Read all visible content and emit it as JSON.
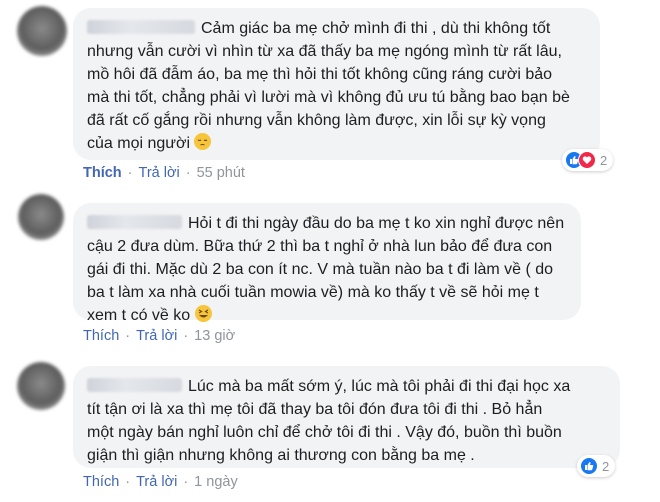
{
  "actions": {
    "like_label": "Thích",
    "reply_label": "Trả lời",
    "separator": "·"
  },
  "comments": [
    {
      "text": "Cảm giác ba mẹ chở mình đi thi , dù thi không tốt\nnhưng vẫn cười vì nhìn từ xa đã thấy ba mẹ ngóng mình từ rất lâu,\nmồ hôi đã đẫm áo, ba mẹ thì hỏi thi tốt không cũng ráng cười bảo\nmà thi tốt, chẳng phải vì lười mà vì không đủ ưu tú bằng bao bạn bè\nđã rất cố gắng rồi nhưng vẫn không làm được, xin lỗi sự kỳ vọng\ncủa mọi người",
      "emoji": "pensive-face",
      "time": "55 phút",
      "reaction_count": "2",
      "reactions": [
        "like",
        "love"
      ]
    },
    {
      "text": "Hỏi t đi thi ngày đầu do ba mẹ t ko xin nghỉ được nên\ncậu 2 đưa dùm. Bữa thứ 2 thì ba t nghỉ ở nhà lun bảo để đưa con\ngái đi thi. Mặc dù 2 ba con ít nc. V mà tuần nào ba t đi làm về ( do\nba t làm xa nhà cuối tuần mowia về) mà ko thấy t về sẽ hỏi mẹ t\nxem t có về ko",
      "emoji": "grinning-squinting-face",
      "time": "13 giờ"
    },
    {
      "text": "Lúc mà ba mất sớm ý, lúc mà tôi phải đi thi đại học xa\ntít tận ơi là xa thì mẹ tôi đã thay ba tôi đón đưa tôi đi thi . Bỏ hẳn\nmột ngày bán nghỉ luôn chỉ để chở tôi đi thi . Vậy đó, buồn thì buồn\ngiận thì giận nhưng không ai thương con bằng ba mẹ .",
      "time": "1 ngày",
      "reaction_count": "2",
      "reactions": [
        "like"
      ]
    }
  ],
  "colors": {
    "link": "#4267b2",
    "meta": "#90949c",
    "bubble": "#f2f3f5",
    "like": "#1877f2",
    "love": "#f0284a"
  }
}
